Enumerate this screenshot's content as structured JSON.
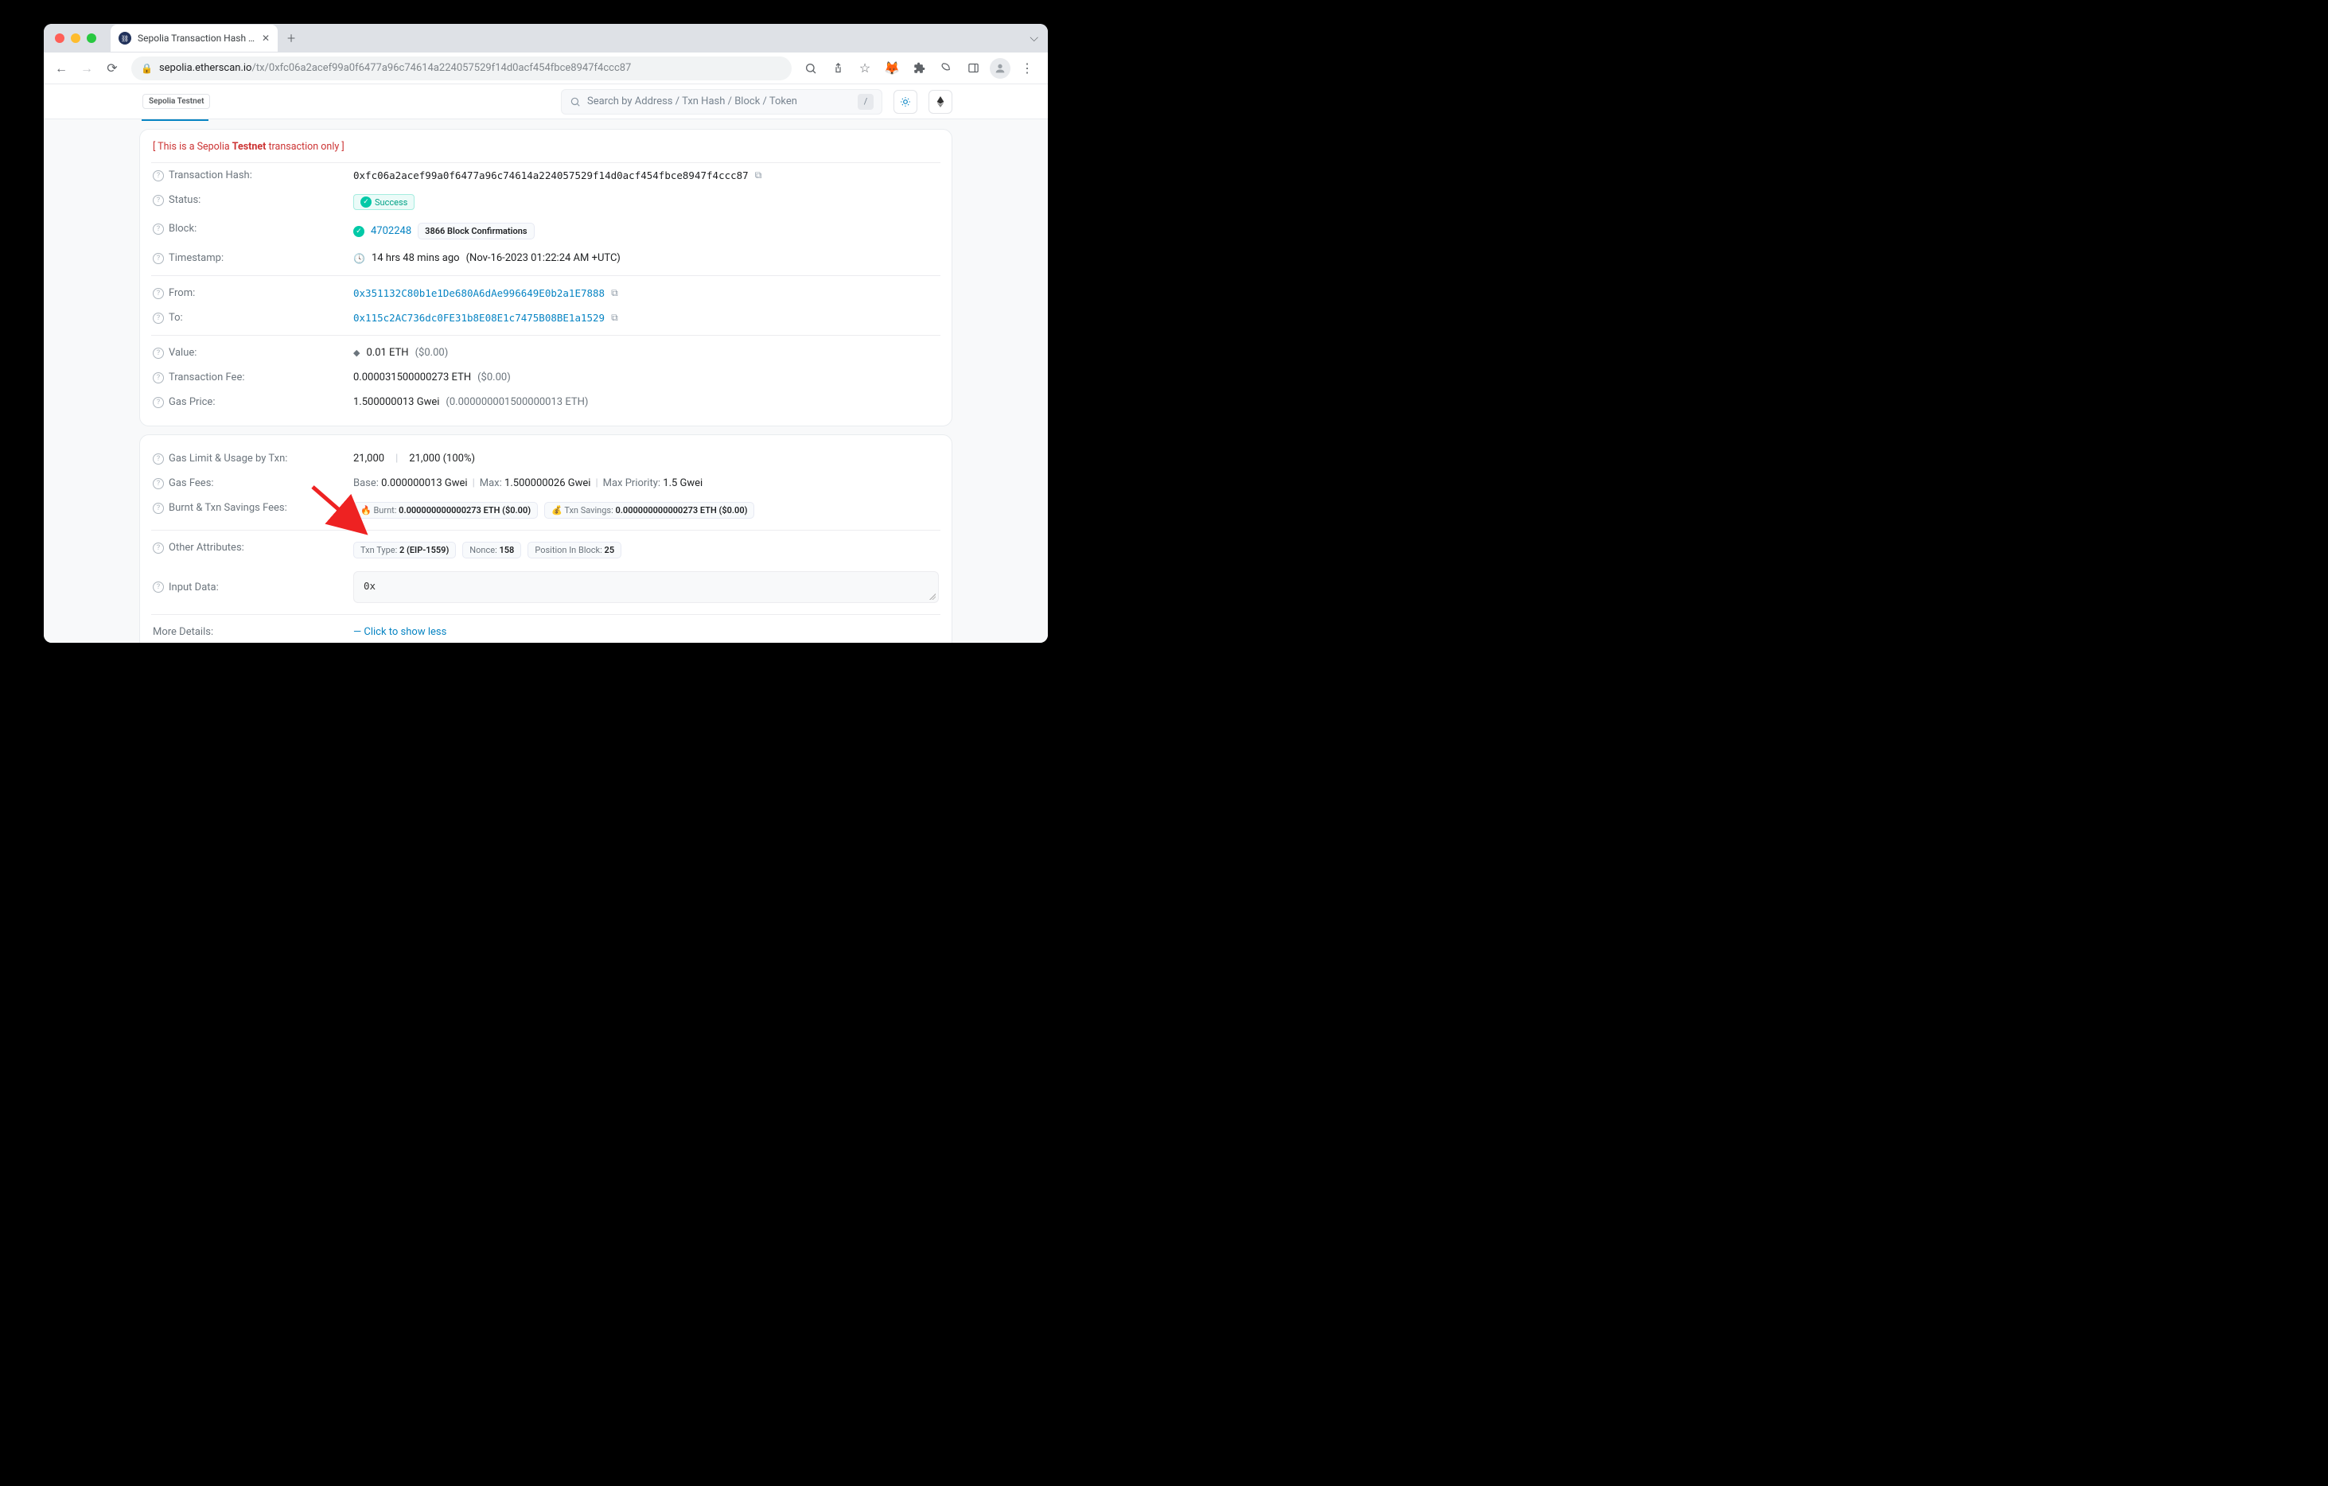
{
  "browser": {
    "tab_title": "Sepolia Transaction Hash (Txh",
    "url_host": "sepolia.etherscan.io",
    "url_path": "/tx/0xfc06a2acef99a0f6477a96c74614a224057529f14d0acf454fbce8947f4ccc87"
  },
  "header": {
    "network_badge": "Sepolia Testnet",
    "search_placeholder": "Search by Address / Txn Hash / Block / Token",
    "slash": "/"
  },
  "notice": {
    "prefix": "[ This is a Sepolia ",
    "bold": "Testnet",
    "suffix": " transaction only ]"
  },
  "tx": {
    "labels": {
      "hash": "Transaction Hash:",
      "status": "Status:",
      "block": "Block:",
      "timestamp": "Timestamp:",
      "from": "From:",
      "to": "To:",
      "value": "Value:",
      "fee": "Transaction Fee:",
      "gas_price": "Gas Price:",
      "gas_limit": "Gas Limit & Usage by Txn:",
      "gas_fees": "Gas Fees:",
      "burnt": "Burnt & Txn Savings Fees:",
      "other": "Other Attributes:",
      "input": "Input Data:",
      "more": "More Details:"
    },
    "hash": "0xfc06a2acef99a0f6477a96c74614a224057529f14d0acf454fbce8947f4ccc87",
    "status": "Success",
    "block_number": "4702248",
    "block_confirm_label": "3866 Block Confirmations",
    "timestamp_rel": "14 hrs 48 mins ago",
    "timestamp_abs": "(Nov-16-2023 01:22:24 AM +UTC)",
    "from": "0x351132C80b1e1De680A6dAe996649E0b2a1E7888",
    "to": "0x115c2AC736dc0FE31b8E08E1c7475B08BE1a1529",
    "value_eth": "0.01 ETH",
    "value_usd": "($0.00)",
    "fee_eth": "0.000031500000273 ETH",
    "fee_usd": "($0.00)",
    "gas_price_gwei": "1.500000013 Gwei",
    "gas_price_eth": "(0.000000001500000013 ETH)",
    "gas_limit": "21,000",
    "gas_used": "21,000 (100%)",
    "gas_fees": {
      "base_lbl": "Base:",
      "base_val": "0.000000013 Gwei",
      "max_lbl": "Max:",
      "max_val": "1.500000026 Gwei",
      "maxp_lbl": "Max Priority:",
      "maxp_val": "1.5 Gwei"
    },
    "burnt_lbl": "Burnt:",
    "burnt_val": "0.000000000000273 ETH ($0.00)",
    "savings_lbl": "Txn Savings:",
    "savings_val": "0.000000000000273 ETH ($0.00)",
    "attr_type_lbl": "Txn Type:",
    "attr_type_val": "2 (EIP-1559)",
    "attr_nonce_lbl": "Nonce:",
    "attr_nonce_val": "158",
    "attr_pos_lbl": "Position In Block:",
    "attr_pos_val": "25",
    "input_data": "0x",
    "more_link": "Click to show less"
  }
}
